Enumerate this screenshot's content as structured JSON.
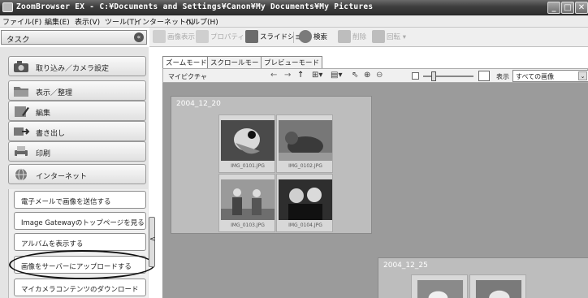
{
  "window": {
    "title": "ZoomBrowser EX - C:¥Documents and Settings¥Canon¥My Documents¥My Pictures",
    "minimize": "_",
    "maximize": "□",
    "close": "✕"
  },
  "menu": [
    "ファイル(F)",
    "編集(E)",
    "表示(V)",
    "ツール(T)",
    "インターネット(I)",
    "ヘルプ(H)"
  ],
  "task_panel": {
    "title": "タスク",
    "collapse_glyph": "«"
  },
  "toolbar": {
    "items": [
      {
        "label": "画像表示",
        "enabled": false
      },
      {
        "label": "プロパティ",
        "enabled": false
      },
      {
        "label": "スライドショー",
        "enabled": true
      },
      {
        "label": "検索",
        "enabled": true
      },
      {
        "label": "削除",
        "enabled": false
      },
      {
        "label": "回転 ▾",
        "enabled": false
      }
    ]
  },
  "categories": [
    {
      "label": "取り込み／カメラ設定",
      "icon": "camera-icon"
    },
    {
      "label": "表示／整理",
      "icon": "folder-icon"
    },
    {
      "label": "編集",
      "icon": "edit-icon"
    },
    {
      "label": "書き出し",
      "icon": "export-icon"
    },
    {
      "label": "印刷",
      "icon": "printer-icon"
    },
    {
      "label": "インターネット",
      "icon": "globe-icon"
    }
  ],
  "internet_tasks": [
    "電子メールで画像を送信する",
    "Image Gatewayのトップページを見る",
    "アルバムを表示する",
    "画像をサーバーにアップロードする",
    "マイカメラコンテンツのダウンロード"
  ],
  "highlighted_task": "画像をサーバーにアップロードする",
  "splitter_glyph": "<",
  "view_tabs": [
    "ズームモード",
    "スクロールモード",
    "プレビューモード"
  ],
  "active_view_tab": "ズームモード",
  "location": "マイピクチャ",
  "nav_glyphs": [
    "←",
    "→",
    "↑",
    "⊞▾",
    "▤▾",
    "⇖",
    "⊕",
    "⊖"
  ],
  "display_label": "表示",
  "display_filter": "すべての画像",
  "display_arrow": "⌄",
  "groups": [
    {
      "title": "2004_12_20",
      "images": [
        "IMG_0101.JPG",
        "IMG_0102.JPG",
        "IMG_0103.JPG",
        "IMG_0104.JPG"
      ]
    },
    {
      "title": "2004_12_25",
      "images": []
    }
  ],
  "colors": {
    "titlebar": "#3e3e3e",
    "viewport_bg": "#9b9b9b",
    "group_bg": "#bdbdbd"
  }
}
